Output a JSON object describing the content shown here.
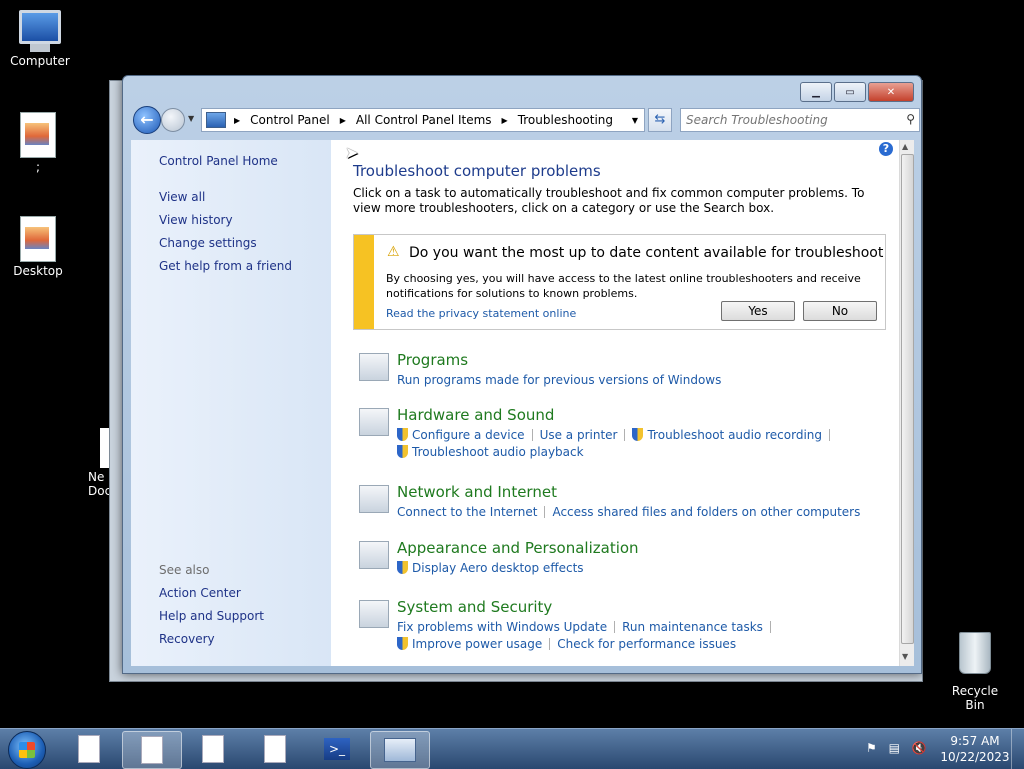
{
  "desktop": {
    "icons": [
      {
        "label": "Computer"
      },
      {
        "label": ";"
      },
      {
        "label": "Desktop"
      },
      {
        "label": "Ne\nDoc"
      },
      {
        "label": "Recycle Bin"
      }
    ]
  },
  "window": {
    "caption_buttons": {
      "minimize": "▁",
      "maximize": "▭",
      "close": "✕"
    },
    "address": {
      "crumbs": [
        "Control Panel",
        "All Control Panel Items",
        "Troubleshooting"
      ]
    },
    "search": {
      "placeholder": "Search Troubleshooting"
    }
  },
  "sidebar": {
    "home": "Control Panel Home",
    "links": [
      "View all",
      "View history",
      "Change settings",
      "Get help from a friend"
    ],
    "see_also_heading": "See also",
    "see_also": [
      "Action Center",
      "Help and Support",
      "Recovery"
    ]
  },
  "main": {
    "title": "Troubleshoot computer problems",
    "description": "Click on a task to automatically troubleshoot and fix common computer problems. To view more troubleshooters, click on a category or use the Search box.",
    "notice": {
      "question": "Do you want the most up to date content available for troubleshoot...",
      "body": "By choosing yes, you will have access to the latest online troubleshooters and receive notifications for solutions to known problems.",
      "privacy_link": "Read the privacy statement online",
      "yes": "Yes",
      "no": "No"
    },
    "categories": [
      {
        "title": "Programs",
        "icon": "programs-icon",
        "lines": [
          [
            {
              "text": "Run programs made for previous versions of Windows",
              "shield": false
            }
          ]
        ]
      },
      {
        "title": "Hardware and Sound",
        "icon": "hardware-sound-icon",
        "lines": [
          [
            {
              "text": "Configure a device",
              "shield": true
            },
            {
              "text": "Use a printer",
              "shield": false
            },
            {
              "text": "Troubleshoot audio recording",
              "shield": true
            }
          ],
          [
            {
              "text": "Troubleshoot audio playback",
              "shield": true
            }
          ]
        ]
      },
      {
        "title": "Network and Internet",
        "icon": "network-icon",
        "lines": [
          [
            {
              "text": "Connect to the Internet",
              "shield": false
            },
            {
              "text": "Access shared files and folders on other computers",
              "shield": false
            }
          ]
        ]
      },
      {
        "title": "Appearance and Personalization",
        "icon": "appearance-icon",
        "lines": [
          [
            {
              "text": "Display Aero desktop effects",
              "shield": true
            }
          ]
        ]
      },
      {
        "title": "System and Security",
        "icon": "system-security-icon",
        "lines": [
          [
            {
              "text": "Fix problems with Windows Update",
              "shield": false
            },
            {
              "text": "Run maintenance tasks",
              "shield": false
            }
          ],
          [
            {
              "text": "Improve power usage",
              "shield": true
            },
            {
              "text": "Check for performance issues",
              "shield": false
            }
          ]
        ]
      }
    ]
  },
  "taskbar": {
    "items": [
      "document",
      "document",
      "document",
      "document",
      "powershell",
      "control-panel"
    ],
    "clock_time": "9:57 AM",
    "clock_date": "10/22/2023"
  }
}
